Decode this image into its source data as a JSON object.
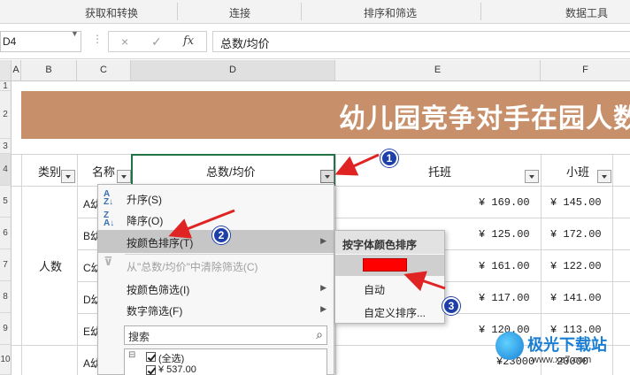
{
  "ribbon": {
    "groups": [
      "获取和转换",
      "连接",
      "排序和筛选",
      "数据工具"
    ]
  },
  "formula_bar": {
    "name_box": "D4",
    "cancel_icon": "×",
    "enter_icon": "✓",
    "fx_label": "fx",
    "content": "总数/均价"
  },
  "columns": [
    "A",
    "B",
    "C",
    "D",
    "E",
    "F"
  ],
  "rows": [
    "1",
    "2",
    "3",
    "4",
    "5",
    "6",
    "7",
    "8",
    "9",
    "10"
  ],
  "sheet": {
    "title": "幼儿园竞争对手在园人数",
    "headers": {
      "category": "类别",
      "name": "名称",
      "total": "总数/均价",
      "tuoban": "托班",
      "xiaoban": "小班"
    },
    "category_value": "人数",
    "rows": [
      {
        "name": "A幼",
        "tuoban": "¥ 169.00",
        "xiaoban": "¥ 145.00"
      },
      {
        "name": "B幼",
        "tuoban": "¥ 125.00",
        "xiaoban": "¥ 172.00"
      },
      {
        "name": "C幼",
        "tuoban": "¥ 161.00",
        "xiaoban": "¥ 122.00"
      },
      {
        "name": "D幼",
        "tuoban": "¥ 117.00",
        "xiaoban": "¥ 141.00"
      },
      {
        "name": "E幼",
        "tuoban": "¥ 120.00",
        "xiaoban": "¥ 113.00"
      },
      {
        "name": "A幼",
        "tuoban": "¥23000",
        "xiaoban": "20000"
      }
    ]
  },
  "filter_menu": {
    "sort_asc": "升序(S)",
    "sort_desc": "降序(O)",
    "sort_by_color": "按颜色排序(T)",
    "clear_filter": "从\"总数/均价\"中清除筛选(C)",
    "filter_by_color": "按颜色筛选(I)",
    "number_filter": "数字筛选(F)",
    "search_placeholder": "搜索",
    "list_items": [
      "(全选)",
      "¥ 537.00"
    ]
  },
  "color_submenu": {
    "header": "按字体颜色排序",
    "swatch_color": "#ff0000",
    "auto": "自动",
    "custom": "自定义排序..."
  },
  "annotations": [
    "1",
    "2",
    "3"
  ],
  "watermark": {
    "text": "极光下载站",
    "url": "www.xz7.com"
  },
  "colors": {
    "banner": "#c8906a",
    "accent_green": "#217346",
    "arrow_red": "#e02424",
    "badge_blue": "#1e3fa8"
  }
}
